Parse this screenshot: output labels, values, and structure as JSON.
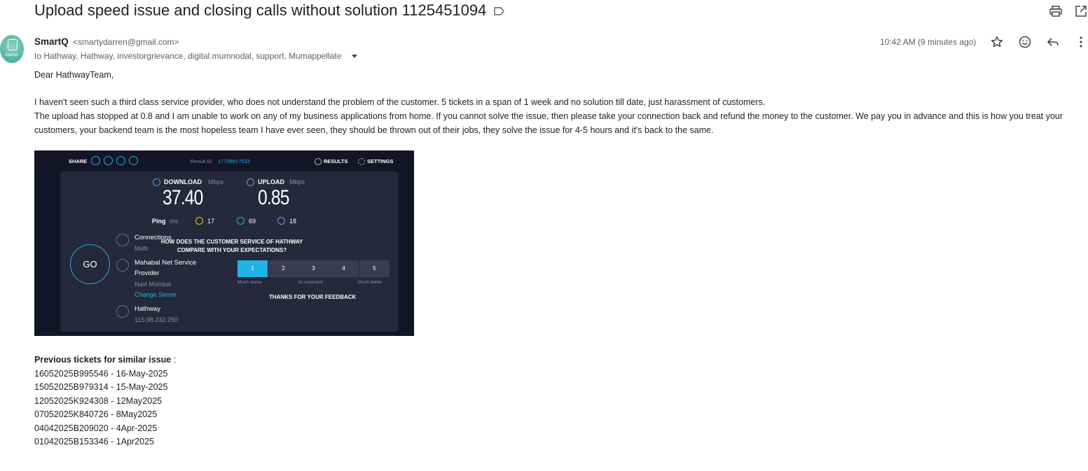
{
  "email": {
    "subject": "Upload speed issue and closing calls without solution 1125451094",
    "sender_name": "SmartQ",
    "sender_email": "<smartydarren@gmail.com>",
    "recipients": "to Hathway, Hathway, investorgrievance, digital.mumnodal, support, Mumappellate",
    "timestamp": "10:42 AM (9 minutes ago)",
    "avatar_text": "Darren",
    "greeting": "Dear HathwayTeam,",
    "paragraph1": "I haven't seen such a third class service provider, who does not understand the problem of the customer. 5 tickets in a span of 1 week and no solution till date, just harassment of customers.",
    "paragraph2": "The upload has stopped at 0.8 and I am unable to work on any of my business applications from home. If you cannot solve the issue, then please take your connection back and refund the money to the customer. We pay you in advance and this is how you treat your customers,  your backend team is the most hopeless team I have ever seen, they should be thrown out of their jobs, they solve the issue for 4-5 hours and it's back to the same.",
    "tickets_heading": "Previous tickets for similar issue",
    "tickets_colon": " :",
    "tickets": [
      "16052025B995546 - 16-May-2025",
      "15052025B979314 - 15-May-2025",
      "12052025K924308 - 12May2025",
      "07052025K840726 - 8May2025",
      "04042025B209020 - 4Apr-2025",
      "01042025B153346 - 1Apr2025"
    ]
  },
  "icons": {
    "label": "label-icon",
    "print": "print-icon",
    "open_new": "open-in-new-window-icon",
    "star": "star-icon",
    "emoji": "emoji-icon",
    "reply": "reply-icon",
    "more": "more-vert-icon"
  },
  "speedtest": {
    "share_label": "SHARE",
    "result_id_label": "Result ID",
    "result_id": "17739917532",
    "results_label": "RESULTS",
    "settings_label": "SETTINGS",
    "download_label": "DOWNLOAD",
    "upload_label": "UPLOAD",
    "unit": "Mbps",
    "download_value": "37.40",
    "upload_value": "0.85",
    "ping_label": "Ping",
    "ping_unit": "ms",
    "ping_idle": "17",
    "ping_down": "69",
    "ping_up": "18",
    "go_label": "GO",
    "connections_label": "Connections",
    "connections_value": "Multi",
    "server_name_1": "Mahabal Net Service",
    "server_name_2": "Provider",
    "server_location": "Navi Mumbai",
    "change_server": "Change Server",
    "isp_name": "Hathway",
    "isp_ip": "115.98.232.250",
    "question_1": "HOW DOES THE CUSTOMER SERVICE OF HATHWAY",
    "question_2": "COMPARE WITH YOUR EXPECTATIONS?",
    "ratings": [
      "1",
      "2",
      "3",
      "4",
      "5"
    ],
    "selected_rating": "1",
    "scale_low": "Much worse",
    "scale_mid": "As expected",
    "scale_high": "Much better",
    "thanks": "THANKS FOR YOUR FEEDBACK",
    "colors": {
      "accent": "#1fb3e8",
      "upload": "#b07ce8",
      "ping": "#e7c84a",
      "bg": "#141526",
      "panel": "#26283b"
    }
  }
}
